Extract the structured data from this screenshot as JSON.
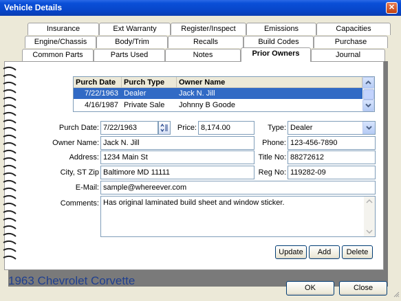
{
  "window": {
    "title": "Vehicle Details",
    "close_glyph": "✕"
  },
  "tabs_row1": [
    "Insurance",
    "Ext Warranty",
    "Register/Inspect",
    "Emissions",
    "Capacities"
  ],
  "tabs_row2": [
    "Engine/Chassis",
    "Body/Trim",
    "Recalls",
    "Build Codes",
    "Purchase"
  ],
  "tabs_row3": [
    "Common Parts",
    "Parts Used",
    "Notes",
    "Prior Owners",
    "Journal"
  ],
  "active_tab": "Prior Owners",
  "owners_grid": {
    "headers": [
      "Purch Date",
      "Purch Type",
      "Owner Name"
    ],
    "rows": [
      {
        "date": "7/22/1963",
        "type": "Dealer",
        "owner": "Jack N. Jill",
        "selected": true
      },
      {
        "date": "4/16/1987",
        "type": "Private Sale",
        "owner": "Johnny B Goode",
        "selected": false
      }
    ]
  },
  "form": {
    "purch_date_label": "Purch Date:",
    "purch_date": "7/22/1963",
    "price_label": "Price:",
    "price": "8,174.00",
    "type_label": "Type:",
    "type": "Dealer",
    "owner_name_label": "Owner Name:",
    "owner_name": "Jack N. Jill",
    "phone_label": "Phone:",
    "phone": "123-456-7890",
    "address_label": "Address:",
    "address": "1234 Main St",
    "title_no_label": "Title No:",
    "title_no": "88272612",
    "city_label": "City, ST Zip",
    "city": "Baltimore MD  11111",
    "reg_no_label": "Reg No:",
    "reg_no": "119282-09",
    "email_label": "E-Mail:",
    "email": "sample@whereever.com",
    "comments_label": "Comments:",
    "comments": "Has original laminated build sheet and window sticker."
  },
  "actions": {
    "update": "Update",
    "add": "Add",
    "delete": "Delete"
  },
  "footer": {
    "vehicle": "1963 Chevrolet Corvette",
    "ok": "OK",
    "close": "Close"
  }
}
